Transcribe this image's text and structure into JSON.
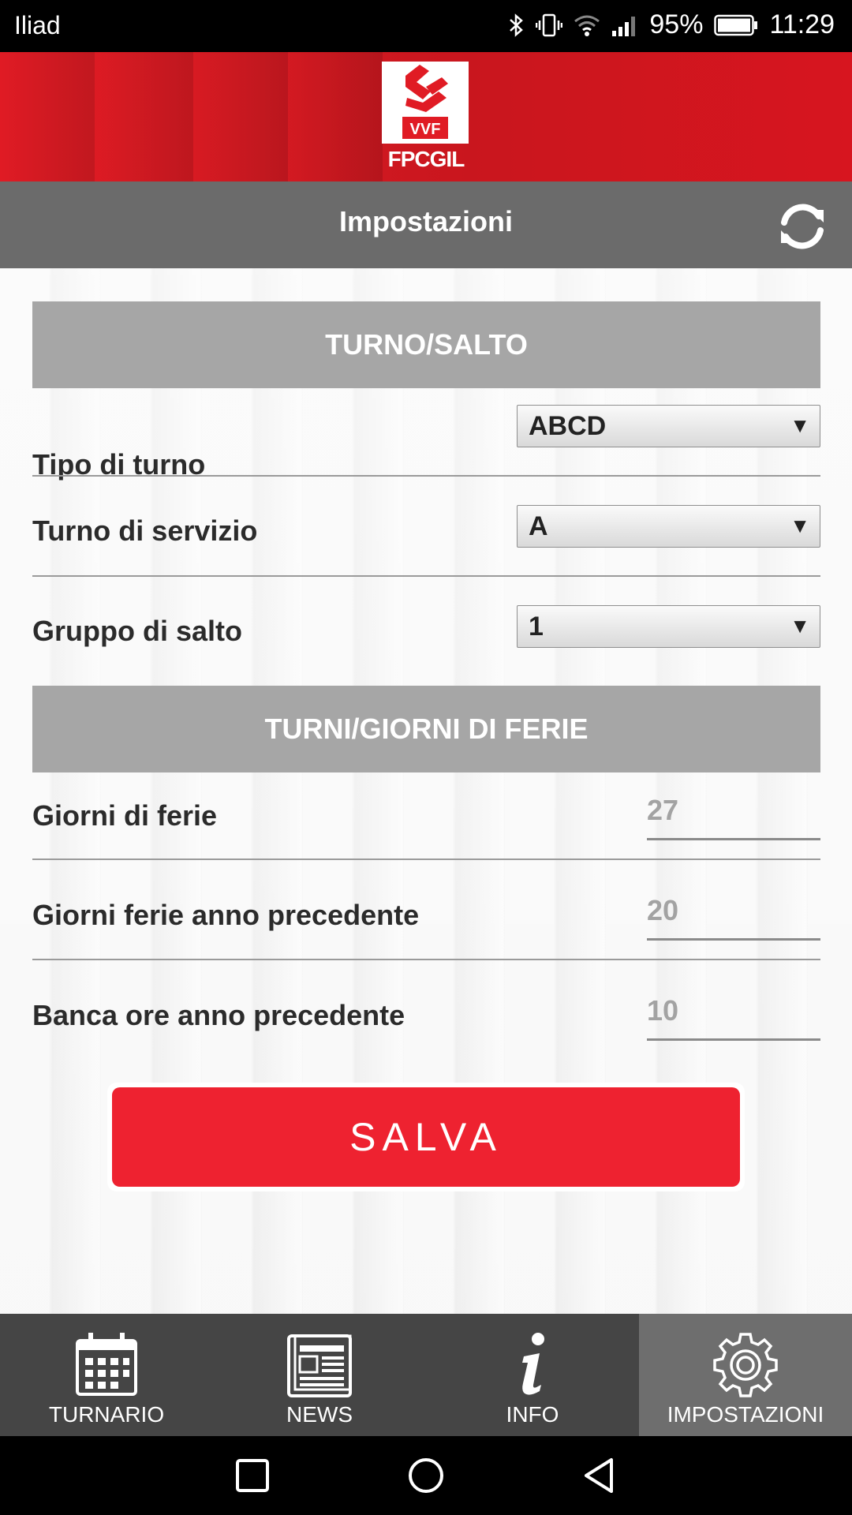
{
  "status_bar": {
    "carrier": "Iliad",
    "battery": "95%",
    "time": "11:29"
  },
  "header": {
    "logo_badge": "VVF",
    "logo_text": "FPCGIL"
  },
  "title_bar": {
    "title": "Impostazioni",
    "refresh_icon": "refresh-icon"
  },
  "sections": {
    "turno_salto": {
      "header": "TURNO/SALTO",
      "rows": [
        {
          "label": "Tipo di turno",
          "value": "ABCD"
        },
        {
          "label": "Turno di servizio",
          "value": "A"
        },
        {
          "label": "Gruppo di salto",
          "value": "1"
        }
      ]
    },
    "ferie": {
      "header": "TURNI/GIORNI DI FERIE",
      "rows": [
        {
          "label": "Giorni di ferie",
          "value": "27"
        },
        {
          "label": "Giorni ferie anno precedente",
          "value": "20"
        },
        {
          "label": "Banca ore anno precedente",
          "value": "10"
        }
      ]
    }
  },
  "save_button": {
    "label": "SALVA",
    "color": "#ee2230"
  },
  "tabs": [
    {
      "label": "TURNARIO",
      "icon": "calendar-icon",
      "active": false
    },
    {
      "label": "NEWS",
      "icon": "newspaper-icon",
      "active": false
    },
    {
      "label": "INFO",
      "icon": "info-icon",
      "active": false
    },
    {
      "label": "IMPOSTAZIONI",
      "icon": "gear-icon",
      "active": true
    }
  ],
  "colors": {
    "brand_red": "#e01b24",
    "title_bar": "#6b6b6b",
    "section_header": "#a6a6a6",
    "tab_bar": "#454545"
  }
}
